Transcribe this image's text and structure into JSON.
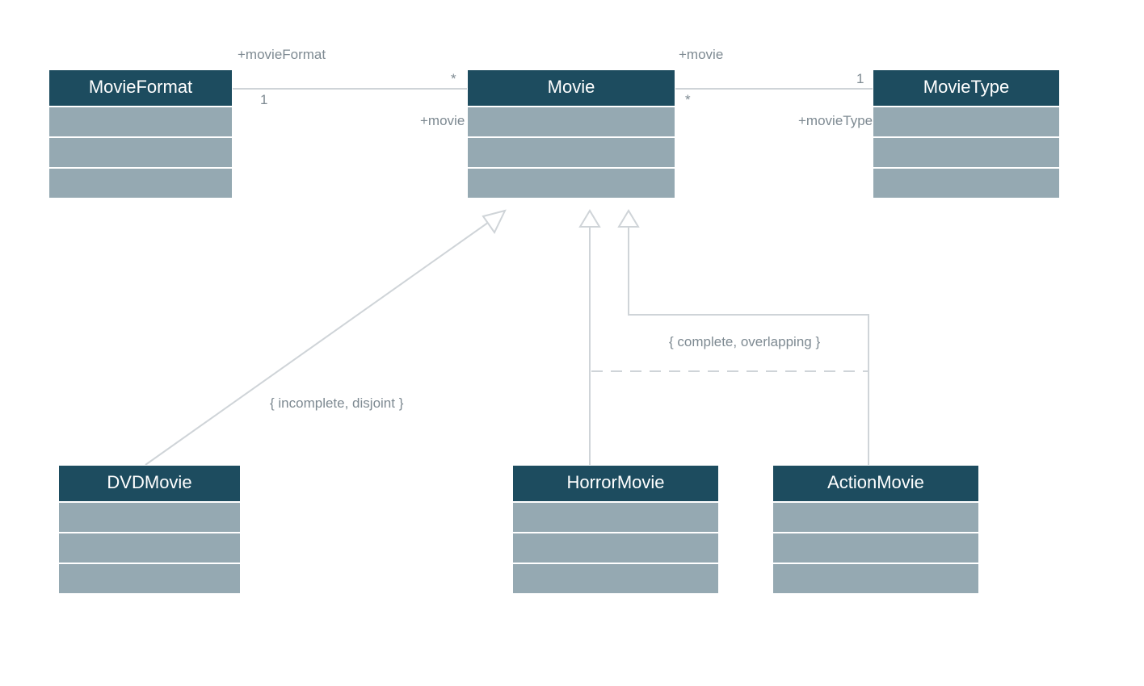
{
  "classes": {
    "movieFormat": {
      "name": "MovieFormat"
    },
    "movie": {
      "name": "Movie"
    },
    "movieType": {
      "name": "MovieType"
    },
    "dvdMovie": {
      "name": "DVDMovie"
    },
    "horrorMovie": {
      "name": "HorrorMovie"
    },
    "actionMovie": {
      "name": "ActionMovie"
    }
  },
  "labels": {
    "assocMovieFormat": "+movieFormat",
    "assocMovieLeft": "+movie",
    "assocMovieTop": "+movie",
    "assocMovieType": "+movieType",
    "multStar1": "*",
    "multOne1": "1",
    "multStar2": "*",
    "multOne2": "1"
  },
  "constraints": {
    "incompleteDisjoint": "{ incomplete, disjoint }",
    "completeOverlapping": "{ complete, overlapping }"
  }
}
